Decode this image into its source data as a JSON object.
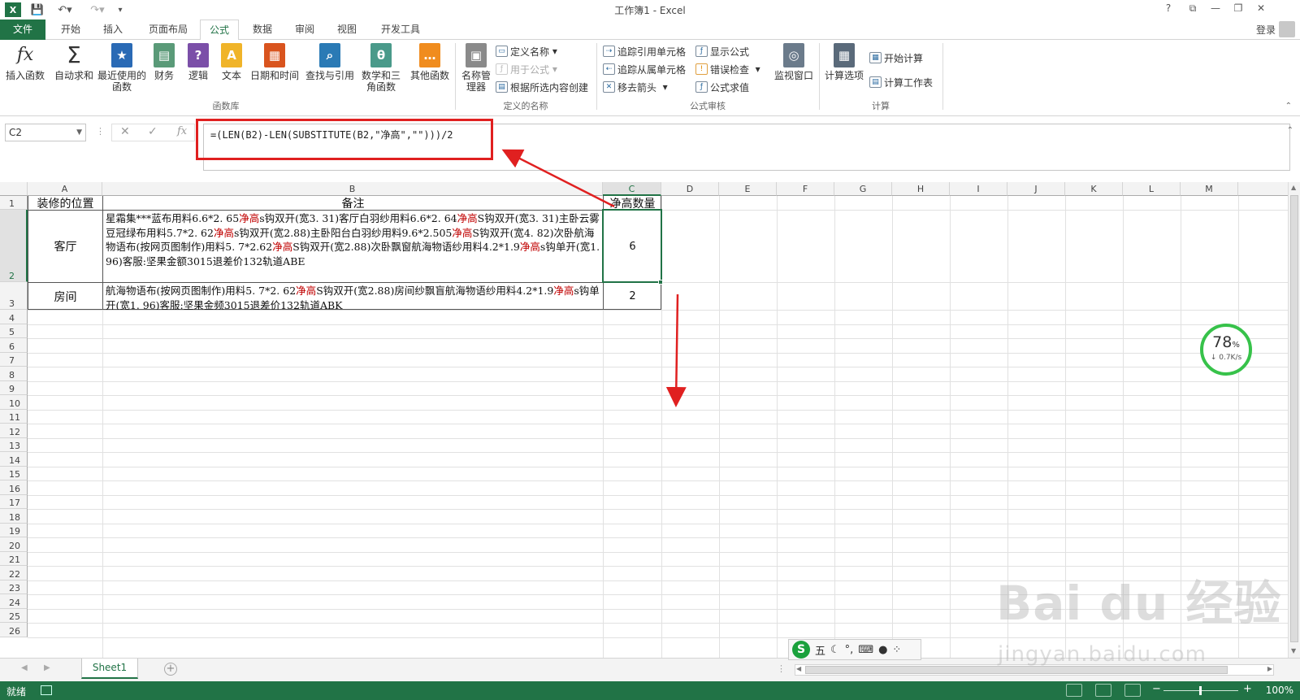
{
  "window": {
    "title": "工作簿1 - Excel",
    "help": "?",
    "controls": [
      "⧉",
      "—",
      "❐",
      "✕"
    ]
  },
  "tabs": {
    "file": "文件",
    "items": [
      "开始",
      "插入",
      "页面布局",
      "公式",
      "数据",
      "审阅",
      "视图",
      "开发工具"
    ],
    "active": "公式",
    "login": "登录"
  },
  "ribbon": {
    "function_library": {
      "label": "函数库",
      "buttons": [
        "插入函数",
        "自动求和",
        "最近使用的函数",
        "财务",
        "逻辑",
        "文本",
        "日期和时间",
        "查找与引用",
        "数学和三角函数",
        "其他函数"
      ]
    },
    "defined_names": {
      "label": "定义的名称",
      "name_manager": "名称管理器",
      "define_name": "定义名称",
      "use_in_formula": "用于公式",
      "create_from_selection": "根据所选内容创建"
    },
    "formula_auditing": {
      "label": "公式审核",
      "trace_precedents": "追踪引用单元格",
      "trace_dependents": "追踪从属单元格",
      "remove_arrows": "移去箭头",
      "show_formulas": "显示公式",
      "error_checking": "错误检查",
      "evaluate_formula": "公式求值",
      "watch_window": "监视窗口"
    },
    "calculation": {
      "label": "计算",
      "calc_options": "计算选项",
      "calc_now": "开始计算",
      "calc_sheet": "计算工作表"
    }
  },
  "formula_bar": {
    "name_box": "C2",
    "formula": "=(LEN(B2)-LEN(SUBSTITUTE(B2,\"净高\",\"\")))/2"
  },
  "grid": {
    "columns": [
      "A",
      "B",
      "C",
      "D",
      "E",
      "F",
      "G",
      "H",
      "I",
      "J",
      "K",
      "L",
      "M"
    ],
    "active_column": "C",
    "active_row": 2,
    "rows": [
      "1",
      "2",
      "3",
      "4",
      "5",
      "6",
      "7",
      "8",
      "9",
      "10",
      "11",
      "12",
      "13",
      "14",
      "15",
      "16",
      "17",
      "18",
      "19",
      "20",
      "21",
      "22",
      "23",
      "24",
      "25",
      "26"
    ],
    "header_a": "装修的位置",
    "header_b": "备注",
    "header_c": "净高数量",
    "row2": {
      "location": "客厅",
      "notes_parts": [
        "星霜集***蓝布用料6.6*2. 65",
        "净高",
        "s钩双开(宽3. 31)客厅白羽纱用料6.6*2. 64",
        "净高",
        "S钩双开(宽3. 31)主卧云雾豆冠绿布用料5.7*2. 62",
        "净高",
        "s钩双开(宽2.88)主卧阳台白羽纱用料9.6*2.505",
        "净高",
        "S钩双开(宽4. 82)次卧航海物语布(按网页图制作)用料5. 7*2.62",
        "净高",
        "S钩双开(宽2.88)次卧飘窗航海物语纱用料4.2*1.9",
        "净高",
        "s钩单开(宽1. 96)客服:坚果金额3015退差价132轨道ABE"
      ],
      "count": "6"
    },
    "row3": {
      "location": "房间",
      "notes_parts": [
        "航海物语布(按网页图制作)用料5. 7*2. 62",
        "净高",
        "S钩双开(宽2.88)房间纱飘盲航海物语纱用料4.2*1.9",
        "净高",
        "s钩单开(宽1. 96)客服:坚果金频3015退差价132轨道ABK"
      ],
      "count": "2"
    }
  },
  "sheets": {
    "tabs": [
      "Sheet1"
    ],
    "add": "+"
  },
  "status": {
    "ready": "就绪",
    "zoom": "100%"
  },
  "overlays": {
    "speed_percent": "78",
    "speed_unit": "%",
    "speed_rate": "↓ 0.7K/s",
    "ime_logo": "S",
    "ime_text": "五",
    "watermark": "Bai du 经验",
    "watermark_url": "jingyan.baidu.com"
  },
  "colors": {
    "excel_green": "#217346",
    "highlight_red": "#e02020",
    "keyword_red": "#c00000"
  }
}
